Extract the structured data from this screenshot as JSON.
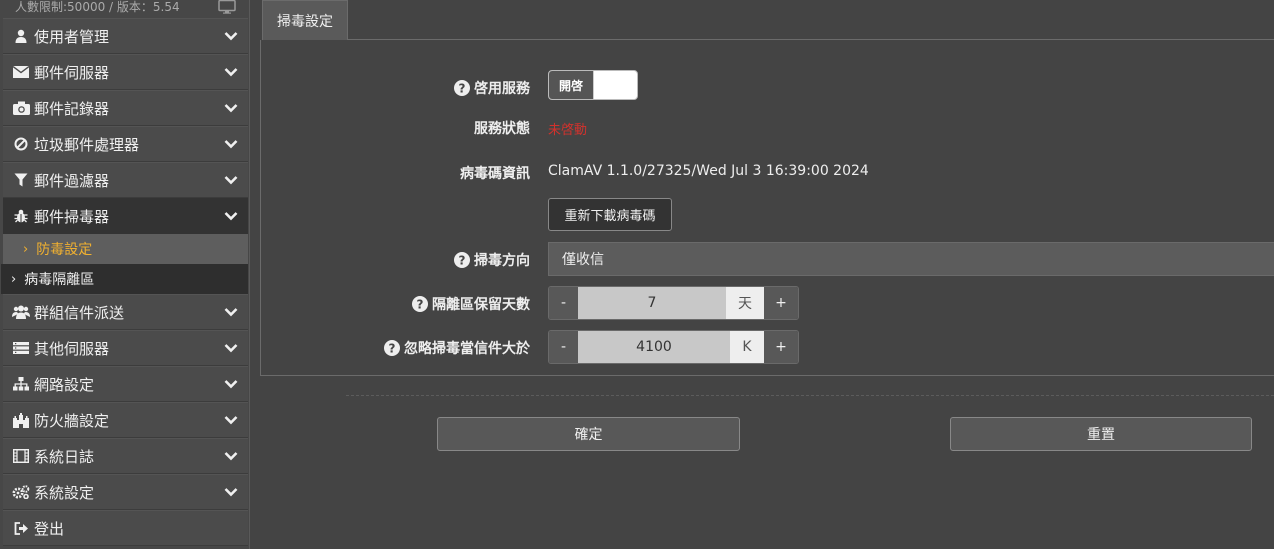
{
  "sidebar": {
    "top_info": "人數限制:50000 / 版本：5.54",
    "items": [
      {
        "label": "使用者管理",
        "icon": "user-icon"
      },
      {
        "label": "郵件伺服器",
        "icon": "envelope-icon"
      },
      {
        "label": "郵件記錄器",
        "icon": "camera-icon"
      },
      {
        "label": "垃圾郵件處理器",
        "icon": "ban-icon"
      },
      {
        "label": "郵件過濾器",
        "icon": "filter-icon"
      },
      {
        "label": "郵件掃毒器",
        "icon": "bug-icon"
      },
      {
        "label": "群組信件派送",
        "icon": "users-icon"
      },
      {
        "label": "其他伺服器",
        "icon": "server-icon"
      },
      {
        "label": "網路設定",
        "icon": "sitemap-icon"
      },
      {
        "label": "防火牆設定",
        "icon": "castle-icon"
      },
      {
        "label": "系統日誌",
        "icon": "film-icon"
      },
      {
        "label": "系統設定",
        "icon": "gears-icon"
      },
      {
        "label": "登出",
        "icon": "sign-out-icon"
      }
    ],
    "subitems": [
      {
        "label": "防毒設定"
      },
      {
        "label": "病毒隔離區"
      }
    ]
  },
  "tab": {
    "label": "掃毒設定"
  },
  "form": {
    "enable_label": "啓用服務",
    "enable_value": "開啓",
    "status_label": "服務狀態",
    "status_value": "未啓動",
    "virusdb_label": "病毒碼資訊",
    "virusdb_value": "ClamAV 1.1.0/27325/Wed Jul 3 16:39:00 2024",
    "reload_button": "重新下載病毒碼",
    "direction_label": "掃毒方向",
    "direction_value": "僅收信",
    "quarantine_label": "隔離區保留天數",
    "quarantine_value": "7",
    "quarantine_unit": "天",
    "ignore_label": "忽略掃毒當信件大於",
    "ignore_value": "4100",
    "ignore_unit": "K",
    "minus": "-",
    "plus": "+"
  },
  "actions": {
    "ok": "確定",
    "reset": "重置"
  },
  "colors": {
    "status_red": "#d2322d",
    "active_sub": "#f0b030"
  }
}
